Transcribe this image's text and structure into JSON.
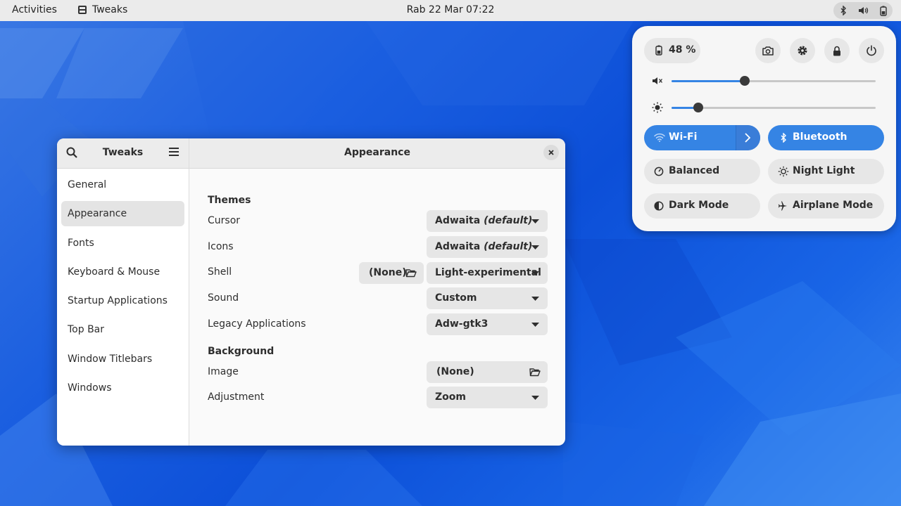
{
  "topbar": {
    "activities": "Activities",
    "app_name": "Tweaks",
    "clock": "Rab 22 Mar  07:22"
  },
  "window": {
    "sidebar_title": "Tweaks",
    "content_title": "Appearance",
    "nav_items": [
      "General",
      "Appearance",
      "Fonts",
      "Keyboard & Mouse",
      "Startup Applications",
      "Top Bar",
      "Window Titlebars",
      "Windows"
    ],
    "active_item": "Appearance"
  },
  "appearance": {
    "themes_heading": "Themes",
    "cursor_label": "Cursor",
    "cursor_value": "Adwaita",
    "cursor_suffix": "(default)",
    "icons_label": "Icons",
    "icons_value": "Adwaita",
    "icons_suffix": "(default)",
    "shell_label": "Shell",
    "shell_file": "(None)",
    "shell_value": "Light-experimental",
    "sound_label": "Sound",
    "sound_value": "Custom",
    "legacy_label": "Legacy Applications",
    "legacy_value": "Adw-gtk3",
    "background_heading": "Background",
    "image_label": "Image",
    "image_value": "(None)",
    "adjustment_label": "Adjustment",
    "adjustment_value": "Zoom"
  },
  "quick_settings": {
    "battery": "48 %",
    "volume_level": 0.36,
    "brightness_level": 0.13,
    "wifi_label": "Wi-Fi",
    "bluetooth_label": "Bluetooth",
    "balanced_label": "Balanced",
    "night_light_label": "Night Light",
    "dark_mode_label": "Dark Mode",
    "airplane_label": "Airplane Mode"
  },
  "colors": {
    "accent": "#3584e4",
    "topbar": "#ebebeb",
    "window_bg": "#fafafa"
  }
}
